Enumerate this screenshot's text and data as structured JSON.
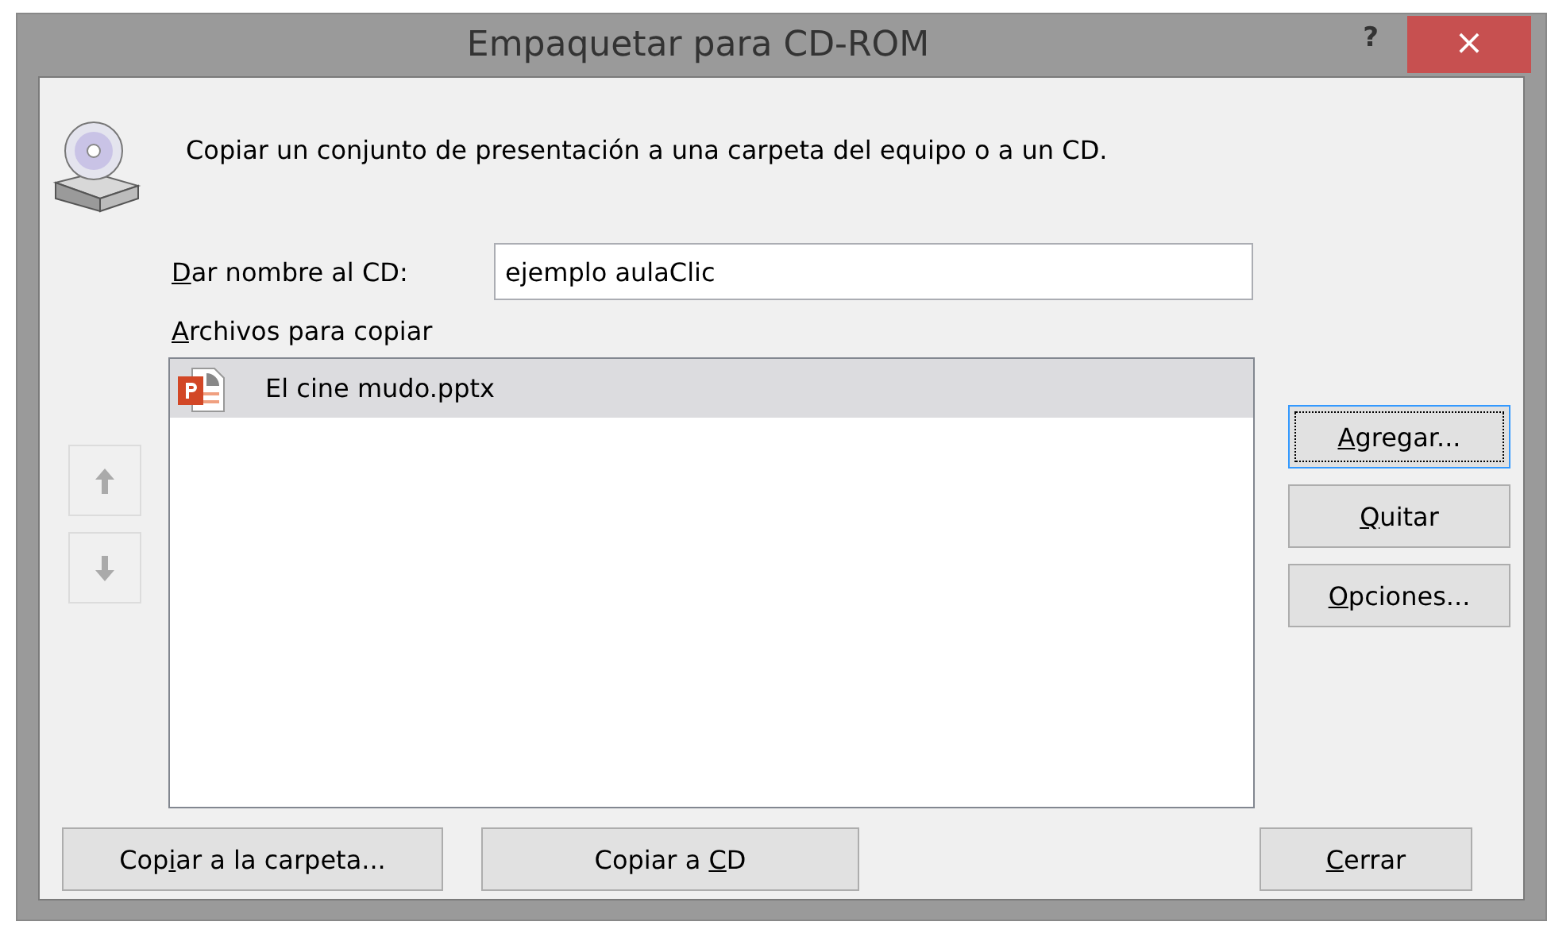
{
  "window": {
    "title": "Empaquetar para CD-ROM",
    "help_button": "?",
    "close_button": "×"
  },
  "description": "Copiar un conjunto de presentación a una carpeta del equipo o a un CD.",
  "cd_name": {
    "label": {
      "key": "D",
      "post": "ar nombre al CD:"
    },
    "value": "ejemplo aulaClic"
  },
  "files": {
    "label": {
      "key": "A",
      "post": "rchivos para copiar"
    },
    "items": [
      {
        "name": "El cine mudo.pptx",
        "selected": true
      }
    ]
  },
  "move_buttons": [
    {
      "kind": "up",
      "disabled": true
    },
    {
      "kind": "down",
      "disabled": true
    }
  ],
  "side_buttons": [
    {
      "label": {
        "key": "A",
        "post": "gregar..."
      },
      "focused": true
    },
    {
      "label": {
        "key": "Q",
        "post": "uitar"
      },
      "focused": false
    },
    {
      "label": {
        "key": "O",
        "post": "pciones..."
      },
      "focused": false
    }
  ],
  "bottom_buttons": [
    {
      "label": {
        "pre": "Cop",
        "key": "i",
        "post": "ar a la carpeta..."
      },
      "kind": "left"
    },
    {
      "label": {
        "pre": "Copiar a ",
        "key": "C",
        "post": "D"
      },
      "kind": "left"
    },
    {
      "label": {
        "key": "C",
        "post": "errar"
      },
      "kind": "right"
    }
  ]
}
